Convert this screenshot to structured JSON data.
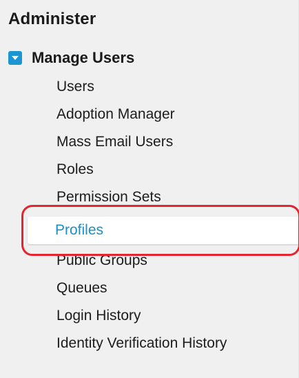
{
  "section": {
    "title": "Administer"
  },
  "group": {
    "label": "Manage Users",
    "toggle_icon": "caret-down-icon",
    "expanded": true,
    "accent": "#1b96d3"
  },
  "items": [
    {
      "label": "Users"
    },
    {
      "label": "Adoption Manager"
    },
    {
      "label": "Mass Email Users"
    },
    {
      "label": "Roles"
    },
    {
      "label": "Permission Sets"
    },
    {
      "label": "Profiles",
      "selected": true
    },
    {
      "label": "Public Groups"
    },
    {
      "label": "Queues"
    },
    {
      "label": "Login History"
    },
    {
      "label": "Identity Verification History"
    }
  ],
  "selected_color": "#1b8fca",
  "annotation_color": "#e3262d"
}
